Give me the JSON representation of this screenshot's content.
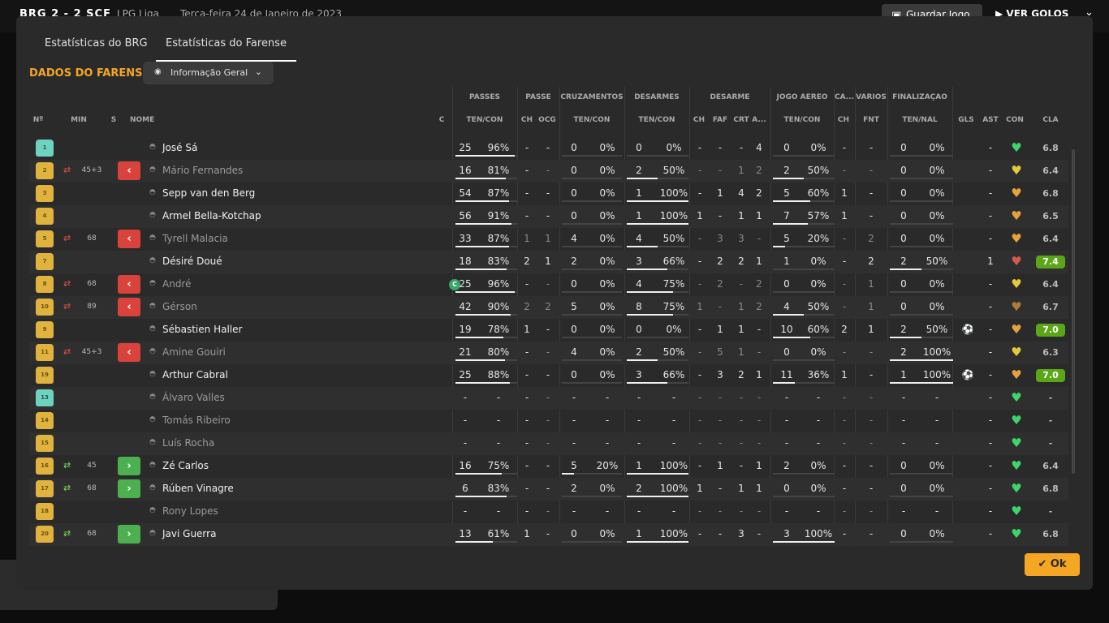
{
  "topbar": {
    "score": "BRG  2 - 2  SCF",
    "league": "LPG Liga",
    "date": "Terça-feira 24 de Janeiro de 2023",
    "save_label": "Guardar Jogo",
    "goals_label": "VER GOLOS"
  },
  "tabs": [
    "Estatísticas do BRG",
    "Estatísticas do Farense"
  ],
  "section_title": "DADOS DO FARENSE",
  "view_select": {
    "label": "Informação Geral"
  },
  "group_headers": [
    "PASSES",
    "PASSE",
    "CRUZAMENTOS",
    "DESARMES",
    "DESARME",
    "JOGO AÉREO",
    "CA...",
    "VÁRIOS",
    "FINALIZAÇÃO"
  ],
  "columns": [
    "Nº",
    "MIN",
    "S",
    "NOME",
    "C",
    "TEN/CON",
    "CH",
    "OCG",
    "TEN/CON",
    "TEN/CON",
    "CH",
    "FAF",
    "CRT",
    "A...",
    "TEN/CON",
    "CH",
    "FNT",
    "TEN/NAL",
    "GLS",
    "AST",
    "CON",
    "CLA"
  ],
  "colors": {
    "accent": "#f5a623",
    "sub_out": "#d9433b",
    "sub_in": "#4caf50",
    "rating_highlight": "#5aa617"
  },
  "players": [
    {
      "no": "1",
      "gk": true,
      "name": "José Sá",
      "dim": false,
      "min": "",
      "sub": "",
      "capt": false,
      "passes": [
        "25",
        "96%"
      ],
      "passes_f": 0.96,
      "passe": [
        "-",
        "-"
      ],
      "cruz": [
        "0",
        "0%"
      ],
      "cruz_f": 0,
      "des": [
        "0",
        "0%"
      ],
      "des_f": 0,
      "desarme": [
        "-",
        "-",
        "-",
        "4"
      ],
      "aereo": [
        "0",
        "0%"
      ],
      "aereo_f": 0,
      "ca": "-",
      "fnt": "-",
      "fin": [
        "0",
        "0%"
      ],
      "fin_f": 0,
      "gls": "",
      "ast": "-",
      "con": "green",
      "cla": "6.8",
      "hl": false
    },
    {
      "no": "2",
      "gk": false,
      "name": "Mário Fernandes",
      "dim": true,
      "min": "45+3",
      "sub": "out",
      "capt": false,
      "passes": [
        "16",
        "81%"
      ],
      "passes_f": 0.81,
      "passe": [
        "-",
        "-"
      ],
      "cruz": [
        "0",
        "0%"
      ],
      "cruz_f": 0,
      "des": [
        "2",
        "50%"
      ],
      "des_f": 0.5,
      "desarme": [
        "-",
        "-",
        "1",
        "2"
      ],
      "aereo": [
        "2",
        "50%"
      ],
      "aereo_f": 0.5,
      "ca": "-",
      "fnt": "-",
      "fin": [
        "0",
        "0%"
      ],
      "fin_f": 0,
      "gls": "",
      "ast": "-",
      "con": "yellow",
      "cla": "6.4",
      "hl": false
    },
    {
      "no": "3",
      "gk": false,
      "name": "Sepp van den Berg",
      "dim": false,
      "min": "",
      "sub": "",
      "capt": false,
      "passes": [
        "54",
        "87%"
      ],
      "passes_f": 0.87,
      "passe": [
        "-",
        "-"
      ],
      "cruz": [
        "0",
        "0%"
      ],
      "cruz_f": 0,
      "des": [
        "1",
        "100%"
      ],
      "des_f": 1,
      "desarme": [
        "-",
        "1",
        "4",
        "2"
      ],
      "aereo": [
        "5",
        "60%"
      ],
      "aereo_f": 0.6,
      "ca": "1",
      "fnt": "-",
      "fin": [
        "0",
        "0%"
      ],
      "fin_f": 0,
      "gls": "",
      "ast": "-",
      "con": "orange",
      "cla": "6.8",
      "hl": false
    },
    {
      "no": "4",
      "gk": false,
      "name": "Armel Bella-Kotchap",
      "dim": false,
      "min": "",
      "sub": "",
      "capt": false,
      "passes": [
        "56",
        "91%"
      ],
      "passes_f": 0.91,
      "passe": [
        "-",
        "-"
      ],
      "cruz": [
        "0",
        "0%"
      ],
      "cruz_f": 0,
      "des": [
        "1",
        "100%"
      ],
      "des_f": 1,
      "desarme": [
        "1",
        "-",
        "1",
        "1"
      ],
      "aereo": [
        "7",
        "57%"
      ],
      "aereo_f": 0.57,
      "ca": "1",
      "fnt": "-",
      "fin": [
        "0",
        "0%"
      ],
      "fin_f": 0,
      "gls": "",
      "ast": "-",
      "con": "orange",
      "cla": "6.5",
      "hl": false
    },
    {
      "no": "5",
      "gk": false,
      "name": "Tyrell Malacia",
      "dim": true,
      "min": "68",
      "sub": "out",
      "capt": false,
      "passes": [
        "33",
        "87%"
      ],
      "passes_f": 0.87,
      "passe": [
        "1",
        "1"
      ],
      "cruz": [
        "4",
        "0%"
      ],
      "cruz_f": 0,
      "des": [
        "4",
        "50%"
      ],
      "des_f": 0.5,
      "desarme": [
        "-",
        "3",
        "3",
        "-"
      ],
      "aereo": [
        "5",
        "20%"
      ],
      "aereo_f": 0.2,
      "ca": "-",
      "fnt": "2",
      "fin": [
        "0",
        "0%"
      ],
      "fin_f": 0,
      "gls": "",
      "ast": "-",
      "con": "orange",
      "cla": "6.4",
      "hl": false
    },
    {
      "no": "7",
      "gk": false,
      "name": "Désiré Doué",
      "dim": false,
      "min": "",
      "sub": "",
      "capt": false,
      "passes": [
        "18",
        "83%"
      ],
      "passes_f": 0.83,
      "passe": [
        "2",
        "1"
      ],
      "cruz": [
        "2",
        "0%"
      ],
      "cruz_f": 0,
      "des": [
        "3",
        "66%"
      ],
      "des_f": 0.66,
      "desarme": [
        "-",
        "2",
        "2",
        "1"
      ],
      "aereo": [
        "1",
        "0%"
      ],
      "aereo_f": 0,
      "ca": "-",
      "fnt": "2",
      "fin": [
        "2",
        "50%"
      ],
      "fin_f": 0.5,
      "gls": "",
      "ast": "1",
      "con": "red",
      "cla": "7.4",
      "hl": true
    },
    {
      "no": "8",
      "gk": false,
      "name": "André",
      "dim": true,
      "min": "68",
      "sub": "out",
      "capt": true,
      "passes": [
        "25",
        "96%"
      ],
      "passes_f": 0.96,
      "passe": [
        "-",
        "-"
      ],
      "cruz": [
        "0",
        "0%"
      ],
      "cruz_f": 0,
      "des": [
        "4",
        "75%"
      ],
      "des_f": 0.75,
      "desarme": [
        "-",
        "2",
        "-",
        "2"
      ],
      "aereo": [
        "0",
        "0%"
      ],
      "aereo_f": 0,
      "ca": "-",
      "fnt": "1",
      "fin": [
        "0",
        "0%"
      ],
      "fin_f": 0,
      "gls": "",
      "ast": "-",
      "con": "yellow",
      "cla": "6.4",
      "hl": false
    },
    {
      "no": "10",
      "gk": false,
      "name": "Gérson",
      "dim": true,
      "min": "89",
      "sub": "out",
      "capt": false,
      "passes": [
        "42",
        "90%"
      ],
      "passes_f": 0.9,
      "passe": [
        "2",
        "2"
      ],
      "cruz": [
        "5",
        "0%"
      ],
      "cruz_f": 0,
      "des": [
        "8",
        "75%"
      ],
      "des_f": 0.75,
      "desarme": [
        "1",
        "-",
        "1",
        "2"
      ],
      "aereo": [
        "4",
        "50%"
      ],
      "aereo_f": 0.5,
      "ca": "-",
      "fnt": "1",
      "fin": [
        "0",
        "0%"
      ],
      "fin_f": 0,
      "gls": "",
      "ast": "-",
      "con": "brown",
      "cla": "6.7",
      "hl": false
    },
    {
      "no": "9",
      "gk": false,
      "name": "Sébastien Haller",
      "dim": false,
      "min": "",
      "sub": "",
      "capt": false,
      "passes": [
        "19",
        "78%"
      ],
      "passes_f": 0.78,
      "passe": [
        "1",
        "-"
      ],
      "cruz": [
        "0",
        "0%"
      ],
      "cruz_f": 0,
      "des": [
        "0",
        "0%"
      ],
      "des_f": 0,
      "desarme": [
        "-",
        "1",
        "1",
        "-"
      ],
      "aereo": [
        "10",
        "60%"
      ],
      "aereo_f": 0.6,
      "ca": "2",
      "fnt": "1",
      "fin": [
        "2",
        "50%"
      ],
      "fin_f": 0.5,
      "gls": "⚽",
      "ast": "-",
      "con": "orange",
      "cla": "7.0",
      "hl": true
    },
    {
      "no": "11",
      "gk": false,
      "name": "Amine Gouiri",
      "dim": true,
      "min": "45+3",
      "sub": "out",
      "capt": false,
      "passes": [
        "21",
        "80%"
      ],
      "passes_f": 0.8,
      "passe": [
        "-",
        "-"
      ],
      "cruz": [
        "4",
        "0%"
      ],
      "cruz_f": 0,
      "des": [
        "2",
        "50%"
      ],
      "des_f": 0.5,
      "desarme": [
        "-",
        "5",
        "1",
        "-"
      ],
      "aereo": [
        "0",
        "0%"
      ],
      "aereo_f": 0,
      "ca": "-",
      "fnt": "-",
      "fin": [
        "2",
        "100%"
      ],
      "fin_f": 1,
      "gls": "",
      "ast": "-",
      "con": "yellow",
      "cla": "6.3",
      "hl": false
    },
    {
      "no": "19",
      "gk": false,
      "name": "Arthur Cabral",
      "dim": false,
      "min": "",
      "sub": "",
      "capt": false,
      "passes": [
        "25",
        "88%"
      ],
      "passes_f": 0.88,
      "passe": [
        "-",
        "-"
      ],
      "cruz": [
        "0",
        "0%"
      ],
      "cruz_f": 0,
      "des": [
        "3",
        "66%"
      ],
      "des_f": 0.66,
      "desarme": [
        "-",
        "3",
        "2",
        "1"
      ],
      "aereo": [
        "11",
        "36%"
      ],
      "aereo_f": 0.36,
      "ca": "1",
      "fnt": "-",
      "fin": [
        "1",
        "100%"
      ],
      "fin_f": 1,
      "gls": "⚽",
      "ast": "-",
      "con": "orange",
      "cla": "7.0",
      "hl": true
    },
    {
      "no": "13",
      "gk": true,
      "name": "Álvaro Valles",
      "dim": true,
      "min": "",
      "sub": "",
      "capt": false,
      "passes": [
        "-",
        "-"
      ],
      "passes_f": -1,
      "passe": [
        "-",
        "-"
      ],
      "cruz": [
        "-",
        "-"
      ],
      "cruz_f": -1,
      "des": [
        "-",
        "-"
      ],
      "des_f": -1,
      "desarme": [
        "-",
        "-",
        "-",
        "-"
      ],
      "aereo": [
        "-",
        "-"
      ],
      "aereo_f": -1,
      "ca": "-",
      "fnt": "-",
      "fin": [
        "-",
        "-"
      ],
      "fin_f": -1,
      "gls": "",
      "ast": "-",
      "con": "green",
      "cla": "-",
      "hl": false
    },
    {
      "no": "14",
      "gk": false,
      "name": "Tomás Ribeiro",
      "dim": true,
      "min": "",
      "sub": "",
      "capt": false,
      "passes": [
        "-",
        "-"
      ],
      "passes_f": -1,
      "passe": [
        "-",
        "-"
      ],
      "cruz": [
        "-",
        "-"
      ],
      "cruz_f": -1,
      "des": [
        "-",
        "-"
      ],
      "des_f": -1,
      "desarme": [
        "-",
        "-",
        "-",
        "-"
      ],
      "aereo": [
        "-",
        "-"
      ],
      "aereo_f": -1,
      "ca": "-",
      "fnt": "-",
      "fin": [
        "-",
        "-"
      ],
      "fin_f": -1,
      "gls": "",
      "ast": "-",
      "con": "green",
      "cla": "-",
      "hl": false
    },
    {
      "no": "15",
      "gk": false,
      "name": "Luís Rocha",
      "dim": true,
      "min": "",
      "sub": "",
      "capt": false,
      "passes": [
        "-",
        "-"
      ],
      "passes_f": -1,
      "passe": [
        "-",
        "-"
      ],
      "cruz": [
        "-",
        "-"
      ],
      "cruz_f": -1,
      "des": [
        "-",
        "-"
      ],
      "des_f": -1,
      "desarme": [
        "-",
        "-",
        "-",
        "-"
      ],
      "aereo": [
        "-",
        "-"
      ],
      "aereo_f": -1,
      "ca": "-",
      "fnt": "-",
      "fin": [
        "-",
        "-"
      ],
      "fin_f": -1,
      "gls": "",
      "ast": "-",
      "con": "green",
      "cla": "-",
      "hl": false
    },
    {
      "no": "16",
      "gk": false,
      "name": "Zé Carlos",
      "dim": false,
      "min": "45",
      "sub": "in",
      "capt": false,
      "passes": [
        "16",
        "75%"
      ],
      "passes_f": 0.75,
      "passe": [
        "-",
        "-"
      ],
      "cruz": [
        "5",
        "20%"
      ],
      "cruz_f": 0.2,
      "des": [
        "1",
        "100%"
      ],
      "des_f": 1,
      "desarme": [
        "-",
        "1",
        "-",
        "1"
      ],
      "aereo": [
        "2",
        "0%"
      ],
      "aereo_f": 0,
      "ca": "-",
      "fnt": "-",
      "fin": [
        "0",
        "0%"
      ],
      "fin_f": 0,
      "gls": "",
      "ast": "-",
      "con": "green",
      "cla": "6.4",
      "hl": false
    },
    {
      "no": "17",
      "gk": false,
      "name": "Rúben Vinagre",
      "dim": false,
      "min": "68",
      "sub": "in",
      "capt": false,
      "passes": [
        "6",
        "83%"
      ],
      "passes_f": 0.83,
      "passe": [
        "-",
        "-"
      ],
      "cruz": [
        "2",
        "0%"
      ],
      "cruz_f": 0,
      "des": [
        "2",
        "100%"
      ],
      "des_f": 1,
      "desarme": [
        "1",
        "-",
        "1",
        "1"
      ],
      "aereo": [
        "0",
        "0%"
      ],
      "aereo_f": 0,
      "ca": "-",
      "fnt": "-",
      "fin": [
        "0",
        "0%"
      ],
      "fin_f": 0,
      "gls": "",
      "ast": "-",
      "con": "green",
      "cla": "6.8",
      "hl": false
    },
    {
      "no": "18",
      "gk": false,
      "name": "Rony Lopes",
      "dim": true,
      "min": "",
      "sub": "",
      "capt": false,
      "passes": [
        "-",
        "-"
      ],
      "passes_f": -1,
      "passe": [
        "-",
        "-"
      ],
      "cruz": [
        "-",
        "-"
      ],
      "cruz_f": -1,
      "des": [
        "-",
        "-"
      ],
      "des_f": -1,
      "desarme": [
        "-",
        "-",
        "-",
        "-"
      ],
      "aereo": [
        "-",
        "-"
      ],
      "aereo_f": -1,
      "ca": "-",
      "fnt": "-",
      "fin": [
        "-",
        "-"
      ],
      "fin_f": -1,
      "gls": "",
      "ast": "-",
      "con": "green",
      "cla": "-",
      "hl": false
    },
    {
      "no": "20",
      "gk": false,
      "name": "Javi Guerra",
      "dim": false,
      "min": "68",
      "sub": "in",
      "capt": false,
      "passes": [
        "13",
        "61%"
      ],
      "passes_f": 0.61,
      "passe": [
        "1",
        "-"
      ],
      "cruz": [
        "0",
        "0%"
      ],
      "cruz_f": 0,
      "des": [
        "1",
        "100%"
      ],
      "des_f": 1,
      "desarme": [
        "-",
        "-",
        "3",
        "-"
      ],
      "aereo": [
        "3",
        "100%"
      ],
      "aereo_f": 1,
      "ca": "-",
      "fnt": "-",
      "fin": [
        "0",
        "0%"
      ],
      "fin_f": 0,
      "gls": "",
      "ast": "-",
      "con": "green",
      "cla": "6.8",
      "hl": false
    }
  ],
  "ok_label": "Ok"
}
